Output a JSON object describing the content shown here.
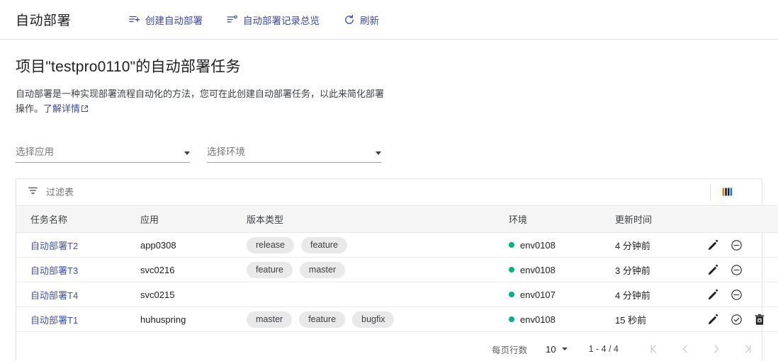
{
  "topbar": {
    "app_title": "自动部署",
    "actions": [
      {
        "label": "创建自动部署",
        "icon": "list-plus-icon"
      },
      {
        "label": "自动部署记录总览",
        "icon": "list-overview-icon"
      },
      {
        "label": "刷新",
        "icon": "refresh-icon"
      }
    ],
    "link_color": "#3949ab"
  },
  "page": {
    "title": "项目\"testpro0110\"的自动部署任务",
    "description": "自动部署是一种实现部署流程自动化的方法，您可在此创建自动部署任务，以此来简化部署操作。",
    "learn_more": "了解详情"
  },
  "filters": {
    "app_select": {
      "label": "选择应用"
    },
    "env_select": {
      "label": "选择环境"
    }
  },
  "table_toolbar": {
    "filter_placeholder": "过滤表",
    "filter_value": "",
    "filter_icon": "filter-icon",
    "columns_icon": "columns-icon"
  },
  "table": {
    "columns": [
      "任务名称",
      "应用",
      "版本类型",
      "环境",
      "更新时间"
    ],
    "rows": [
      {
        "name": "自动部署T2",
        "app": "app0308",
        "types": [
          "release",
          "feature"
        ],
        "env": "env0108",
        "env_status_color": "#00b386",
        "updated": "4 分钟前",
        "actions": [
          "edit-icon",
          "disable-icon"
        ]
      },
      {
        "name": "自动部署T3",
        "app": "svc0216",
        "types": [
          "feature",
          "master"
        ],
        "env": "env0108",
        "env_status_color": "#00b386",
        "updated": "3 分钟前",
        "actions": [
          "edit-icon",
          "disable-icon"
        ]
      },
      {
        "name": "自动部署T4",
        "app": "svc0215",
        "types": [],
        "env": "env0107",
        "env_status_color": "#00b386",
        "updated": "4 分钟前",
        "actions": [
          "edit-icon",
          "disable-icon"
        ]
      },
      {
        "name": "自动部署T1",
        "app": "huhuspring",
        "types": [
          "master",
          "feature",
          "bugfix"
        ],
        "env": "env0108",
        "env_status_color": "#00b386",
        "updated": "15 秒前",
        "actions": [
          "edit-icon",
          "enable-icon",
          "delete-icon"
        ]
      }
    ]
  },
  "pagination": {
    "rows_label": "每页行数",
    "rows_per_page": "10",
    "range": "1 - 4 / 4",
    "nav": [
      "first-page-icon",
      "prev-page-icon",
      "next-page-icon",
      "last-page-icon"
    ]
  },
  "colors": {
    "link": "#3f51b5",
    "status_green": "#00b386",
    "chip_bg": "#e9e9e9"
  }
}
